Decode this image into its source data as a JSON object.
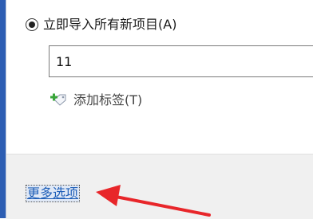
{
  "import_option": {
    "label": "立即导入所有新项目(A)",
    "selected": true
  },
  "input": {
    "value": "11"
  },
  "add_tag": {
    "label": "添加标签(T)",
    "icon": "tag-add-icon"
  },
  "footer": {
    "more_options_label": "更多选项"
  },
  "annotation": {
    "arrow_color": "#e8262a",
    "icon": "red-arrow-icon"
  },
  "colors": {
    "link": "#1f5fb8",
    "window_edge": "#2d5eb3",
    "footer_bg": "#f0f0f0"
  }
}
